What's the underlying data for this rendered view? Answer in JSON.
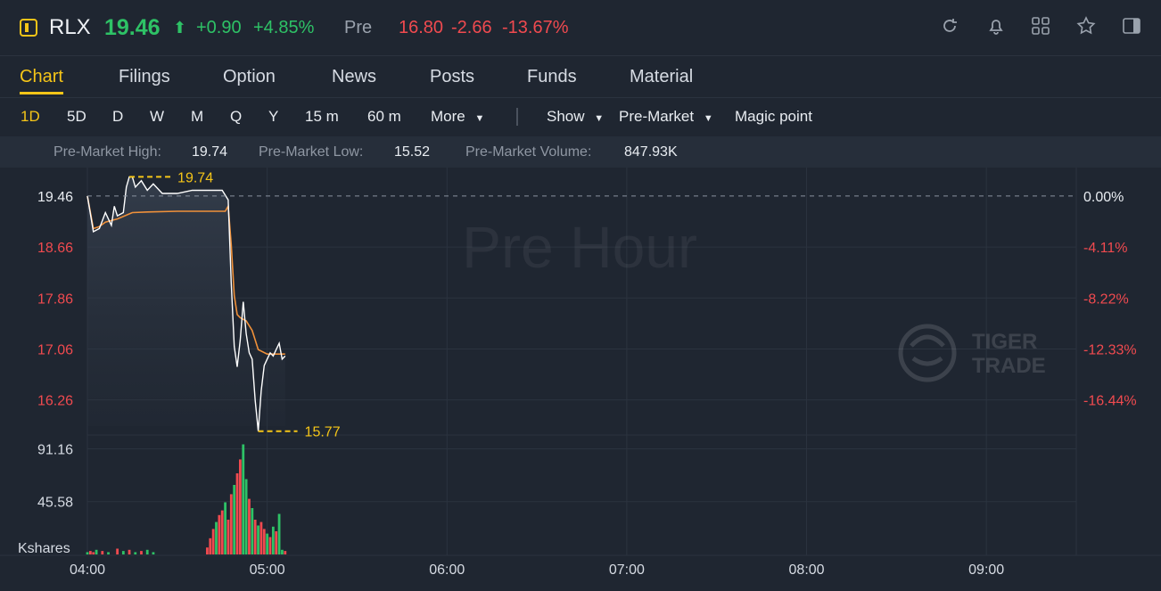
{
  "header": {
    "symbol": "RLX",
    "price": "19.46",
    "change": "+0.90",
    "change_pct": "+4.85%",
    "session_label": "Pre",
    "pre_price": "16.80",
    "pre_change": "-2.66",
    "pre_change_pct": "-13.67%",
    "icons": [
      "refresh-icon",
      "bell-icon",
      "grid-icon",
      "star-icon",
      "panel-toggle-icon"
    ]
  },
  "tabs": [
    "Chart",
    "Filings",
    "Option",
    "News",
    "Posts",
    "Funds",
    "Material"
  ],
  "active_tab": "Chart",
  "toolbar": {
    "periods": [
      "1D",
      "5D",
      "D",
      "W",
      "M",
      "Q",
      "Y",
      "15 m",
      "60 m"
    ],
    "more_label": "More",
    "show_label": "Show",
    "premarket_label": "Pre-Market",
    "magic_label": "Magic point"
  },
  "stats": {
    "high_label": "Pre-Market High:",
    "high_value": "19.74",
    "low_label": "Pre-Market Low:",
    "low_value": "15.52",
    "volume_label": "Pre-Market Volume:",
    "volume_value": "847.93K"
  },
  "colors": {
    "up": "#2ec266",
    "down": "#f04a4f",
    "accent": "#f5c518",
    "avg_line": "#f0913a"
  },
  "chart_data": {
    "type": "line",
    "watermark": "Pre Hour",
    "brand_watermark": [
      "TIGER",
      "TRADE"
    ],
    "price_ticks": [
      "19.46",
      "18.66",
      "17.86",
      "17.06",
      "16.26"
    ],
    "pct_ticks": [
      "0.00%",
      "-4.11%",
      "-8.22%",
      "-12.33%",
      "-16.44%"
    ],
    "volume_ticks": [
      "91.16",
      "45.58"
    ],
    "volume_unit": "Kshares",
    "x_ticks": [
      "04:00",
      "05:00",
      "06:00",
      "07:00",
      "08:00",
      "09:00"
    ],
    "x_range": [
      "04:00",
      "09:30"
    ],
    "y_range": [
      15.85,
      19.85
    ],
    "reference_price": 19.46,
    "max_marker": "19.74",
    "min_marker": "15.77",
    "series": [
      {
        "kind": "price",
        "x": [
          "04:00",
          "04:02",
          "04:04",
          "04:06",
          "04:08",
          "04:09",
          "04:10",
          "04:12",
          "04:13",
          "04:14",
          "04:15",
          "04:16",
          "04:18",
          "04:20",
          "04:22",
          "04:25",
          "04:30",
          "04:35",
          "04:40",
          "04:45",
          "04:47",
          "04:48",
          "04:49",
          "04:50",
          "04:51",
          "04:52",
          "04:53",
          "04:54",
          "04:55",
          "04:56",
          "04:57",
          "04:58",
          "04:59",
          "05:00",
          "05:01",
          "05:02",
          "05:03",
          "05:04",
          "05:05",
          "05:06"
        ],
        "values": [
          19.46,
          18.9,
          18.95,
          19.2,
          19.0,
          19.3,
          19.15,
          19.2,
          19.6,
          19.76,
          19.76,
          19.6,
          19.7,
          19.55,
          19.65,
          19.5,
          19.5,
          19.55,
          19.55,
          19.55,
          19.4,
          18.1,
          17.1,
          16.78,
          17.2,
          17.8,
          17.3,
          17.0,
          16.9,
          16.25,
          15.77,
          16.4,
          16.8,
          16.9,
          17.0,
          16.95,
          17.05,
          17.15,
          16.9,
          16.95
        ]
      },
      {
        "kind": "average",
        "x": [
          "04:00",
          "04:02",
          "04:04",
          "04:06",
          "04:10",
          "04:15",
          "04:20",
          "04:30",
          "04:40",
          "04:46",
          "04:47",
          "04:48",
          "04:49",
          "04:50",
          "04:51",
          "04:53",
          "04:55",
          "04:57",
          "05:00",
          "05:03",
          "05:06"
        ],
        "values": [
          19.46,
          18.95,
          18.98,
          19.05,
          19.1,
          19.2,
          19.21,
          19.22,
          19.22,
          19.22,
          19.3,
          18.7,
          17.9,
          17.6,
          17.55,
          17.5,
          17.35,
          17.05,
          16.98,
          16.98,
          16.98
        ]
      }
    ],
    "volume": {
      "x": [
        "04:00",
        "04:01",
        "04:02",
        "04:03",
        "04:05",
        "04:07",
        "04:10",
        "04:12",
        "04:14",
        "04:16",
        "04:18",
        "04:20",
        "04:22",
        "04:40",
        "04:41",
        "04:42",
        "04:43",
        "04:44",
        "04:45",
        "04:46",
        "04:47",
        "04:48",
        "04:49",
        "04:50",
        "04:51",
        "04:52",
        "04:53",
        "04:54",
        "04:55",
        "04:56",
        "04:57",
        "04:58",
        "04:59",
        "05:00",
        "05:01",
        "05:02",
        "05:03",
        "05:04",
        "05:05",
        "05:06"
      ],
      "values": [
        2,
        3,
        2,
        4,
        3,
        2,
        5,
        3,
        4,
        2,
        3,
        4,
        2,
        6,
        14,
        22,
        28,
        34,
        38,
        45,
        30,
        52,
        60,
        70,
        82,
        95,
        65,
        48,
        40,
        30,
        25,
        28,
        22,
        18,
        15,
        24,
        20,
        35,
        4,
        3
      ],
      "direction": [
        "up",
        "down",
        "down",
        "up",
        "down",
        "up",
        "down",
        "up",
        "down",
        "up",
        "down",
        "up",
        "up",
        "down",
        "down",
        "down",
        "up",
        "down",
        "down",
        "up",
        "down",
        "down",
        "up",
        "down",
        "down",
        "up",
        "up",
        "down",
        "up",
        "down",
        "up",
        "down",
        "down",
        "up",
        "down",
        "up",
        "down",
        "up",
        "up",
        "down"
      ]
    }
  }
}
